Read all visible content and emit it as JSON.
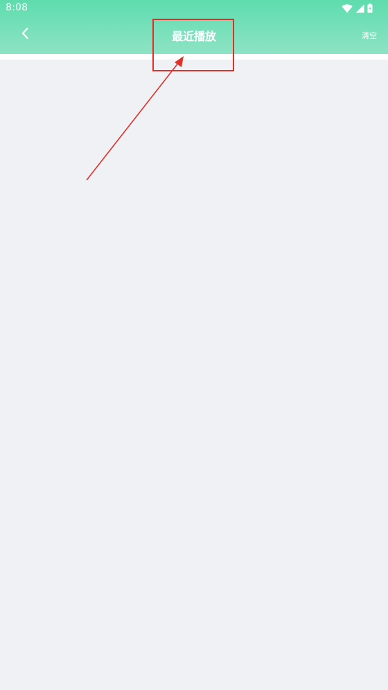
{
  "status_bar": {
    "time": "8:08",
    "icons": [
      "wifi-icon",
      "signal-icon",
      "battery-icon"
    ]
  },
  "toolbar": {
    "back_icon": "chevron-left-icon",
    "title": "最近播放",
    "clear_label": "清空"
  },
  "colors": {
    "header_top": "#5edcae",
    "header_bottom": "#8ee3c5",
    "background": "#f0f1f5",
    "annotation": "#e0302a"
  }
}
